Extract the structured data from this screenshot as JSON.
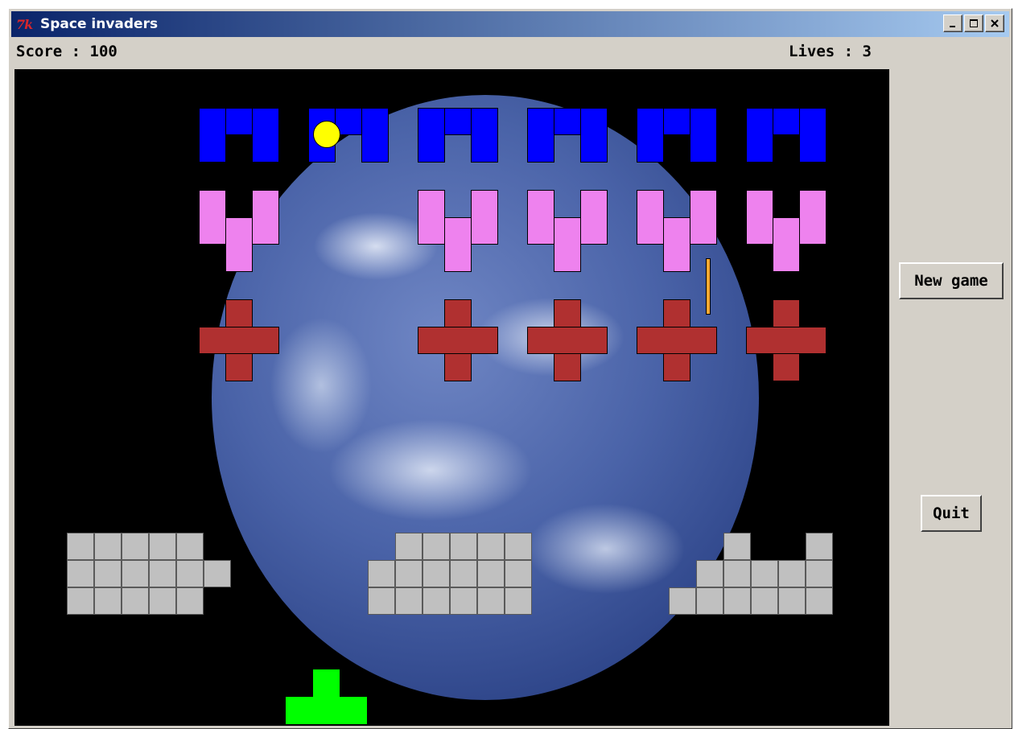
{
  "window": {
    "title": "Space invaders",
    "logo_text": "7k"
  },
  "hud": {
    "score_label": "Score : 100",
    "lives_label": "Lives : 3"
  },
  "buttons": {
    "new_game": "New game",
    "quit": "Quit"
  },
  "colors": {
    "invader_row1": "#0000ff",
    "invader_row2": "#ee82ee",
    "invader_row3": "#b03030",
    "bunker": "#c0c0c0",
    "player": "#00ff00",
    "ball": "#ffff00",
    "background": "#000000"
  },
  "icons": {
    "minimize": "minimize-icon",
    "maximize": "maximize-icon",
    "close": "close-icon"
  }
}
